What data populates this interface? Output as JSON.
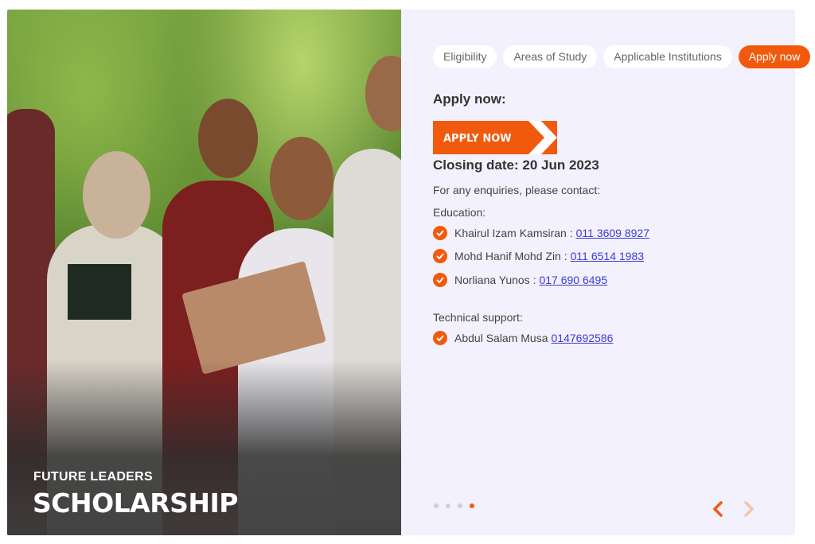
{
  "hero": {
    "subtitle": "FUTURE LEADERS",
    "title": "SCHOLARSHIP"
  },
  "tabs": [
    {
      "label": "Eligibility",
      "active": false
    },
    {
      "label": "Areas of Study",
      "active": false
    },
    {
      "label": "Applicable Institutions",
      "active": false
    },
    {
      "label": "Apply now",
      "active": true
    }
  ],
  "panel": {
    "heading": "Apply now:",
    "apply_button_label": "APPLY NOW",
    "closing_date": "Closing date: 20 Jun 2023",
    "enquiry_text": "For any enquiries, please contact:",
    "education_label": "Education:",
    "education_contacts": [
      {
        "name": "Khairul Izam Kamsiran :",
        "phone": "011 3609 8927"
      },
      {
        "name": "Mohd Hanif Mohd Zin :",
        "phone": "011 6514 1983"
      },
      {
        "name": "Norliana Yunos :",
        "phone": "017 690 6495"
      }
    ],
    "technical_label": "Technical support:",
    "technical_contacts": [
      {
        "name": "Abdul Salam Musa",
        "phone": "0147692586"
      }
    ]
  },
  "carousel": {
    "dot_count": 4,
    "active_index": 3
  },
  "colors": {
    "accent": "#f15a0d",
    "panel_bg": "#f3f1fd",
    "link": "#3b3bd6"
  }
}
